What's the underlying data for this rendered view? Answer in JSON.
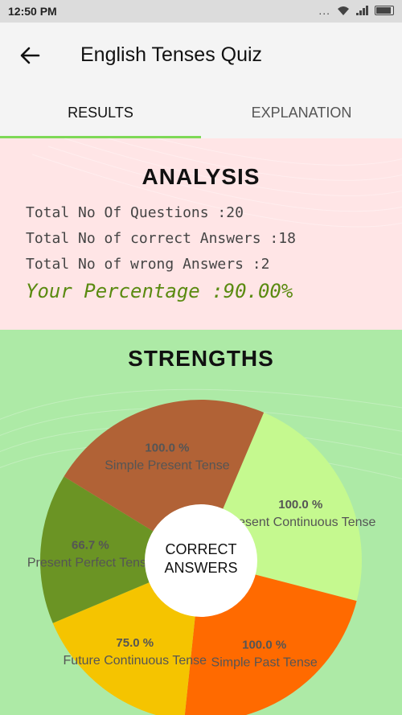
{
  "status_bar": {
    "time": "12:50 PM",
    "dots": "..."
  },
  "app_bar": {
    "title": "English Tenses Quiz"
  },
  "tabs": [
    {
      "label": "RESULTS",
      "active": true
    },
    {
      "label": "EXPLANATION",
      "active": false
    }
  ],
  "analysis": {
    "heading": "ANALYSIS",
    "total_questions": "Total No Of Questions :20",
    "correct_answers": "Total No of correct Answers :18",
    "wrong_answers": "Total No of wrong Answers :2",
    "percentage": "Your Percentage :90.00%"
  },
  "strengths": {
    "heading": "STRENGTHS",
    "center_line1": "CORRECT",
    "center_line2": "ANSWERS"
  },
  "chart_data": {
    "type": "pie",
    "center_label": "CORRECT ANSWERS",
    "slices": [
      {
        "name": "Present Continuous Tense",
        "value_label": "100.0 %",
        "value": 100.0,
        "color": "#c5f98f"
      },
      {
        "name": "Simple Past Tense",
        "value_label": "100.0 %",
        "value": 100.0,
        "color": "#ff6a00"
      },
      {
        "name": "Future Continuous Tense",
        "value_label": "75.0 %",
        "value": 75.0,
        "color": "#f5c400"
      },
      {
        "name": "Present Perfect Tense",
        "value_label": "66.7 %",
        "value": 66.7,
        "color": "#6b9424"
      },
      {
        "name": "Simple Present Tense",
        "value_label": "100.0 %",
        "value": 100.0,
        "color": "#b16236"
      }
    ]
  }
}
